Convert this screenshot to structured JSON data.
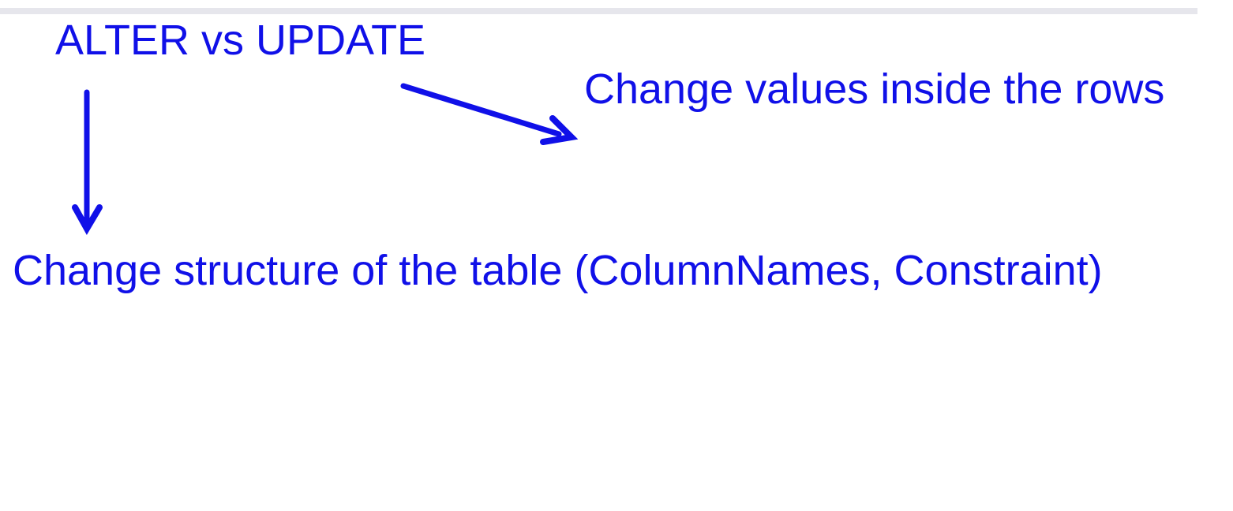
{
  "diagram": {
    "title": "ALTER vs UPDATE",
    "update_description": "Change values inside the rows",
    "alter_description": "Change structure of the table (ColumnNames, Constraint)"
  },
  "colors": {
    "ink": "#1010e8",
    "top_rule": "#e6e6ec",
    "background": "#ffffff"
  }
}
